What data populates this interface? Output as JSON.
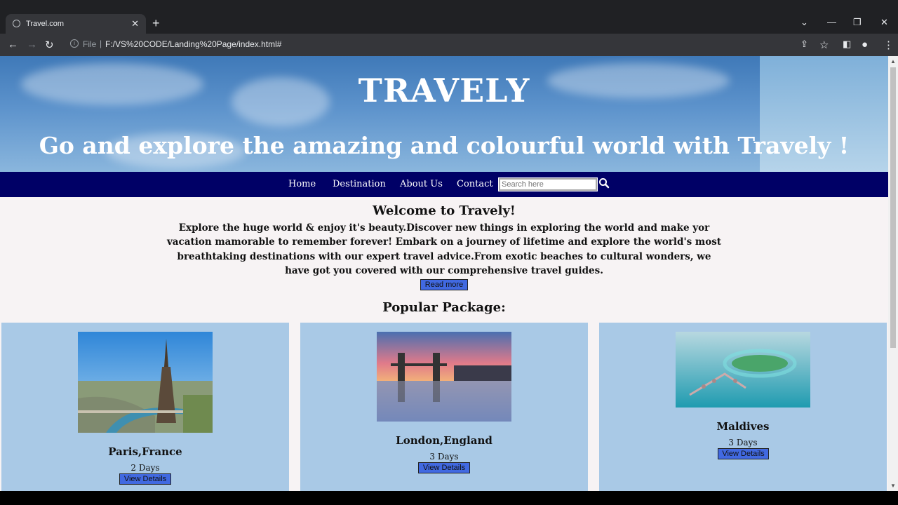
{
  "browser": {
    "tab_title": "Travel.com",
    "new_tab": "+",
    "close_tab": "✕",
    "url_scheme_label": "File",
    "url": "F:/VS%20CODE/Landing%20Page/index.html#"
  },
  "hero": {
    "brand": "TRAVELY",
    "tagline": "Go and explore the amazing and colourful world with Travely !"
  },
  "nav": {
    "items": [
      "Home",
      "Destination",
      "About Us",
      "Contact"
    ],
    "search_placeholder": "Search here"
  },
  "welcome": {
    "heading": "Welcome to Travely!",
    "text": "Explore the huge world & enjoy it's beauty.Discover new things in exploring the world and make yor vacation mamorable to remember forever! Embark on a journey of lifetime and explore the world's most breathtaking destinations with our expert travel advice.From exotic beaches to cultural wonders, we have got you covered with our comprehensive travel guides.",
    "read_more": "Read more"
  },
  "packages": {
    "heading": "Popular Package:",
    "items": [
      {
        "name": "Paris,France",
        "days": "2 Days",
        "button": "View Details"
      },
      {
        "name": "London,England",
        "days": "3 Days",
        "button": "View Details"
      },
      {
        "name": "Maldives",
        "days": "3 Days",
        "button": "View Details"
      }
    ]
  },
  "colors": {
    "nav_bg": "#000066",
    "card_bg": "#a9c9e6",
    "button_bg": "#4169e1",
    "page_bg": "#f7f3f4"
  }
}
